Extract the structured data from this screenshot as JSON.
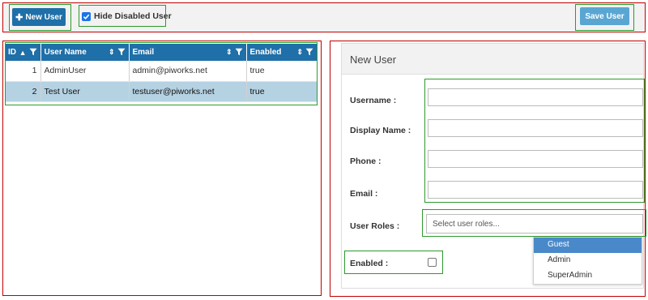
{
  "toolbar": {
    "new_user_label": "New User",
    "hide_disabled_label": "Hide Disabled User",
    "hide_disabled_checked": true,
    "save_label": "Save User"
  },
  "grid": {
    "columns": [
      "ID",
      "User Name",
      "Email",
      "Enabled"
    ],
    "rows": [
      {
        "id": "1",
        "name": "AdminUser",
        "email": "admin@piworks.net",
        "enabled": "true",
        "selected": false
      },
      {
        "id": "2",
        "name": "Test User",
        "email": "testuser@piworks.net",
        "enabled": "true",
        "selected": true
      }
    ]
  },
  "form": {
    "title": "New User",
    "username_label": "Username :",
    "display_name_label": "Display Name :",
    "phone_label": "Phone :",
    "email_label": "Email :",
    "roles_label": "User Roles :",
    "roles_placeholder": "Select user roles...",
    "enabled_label": "Enabled :",
    "roles_options": [
      "Guest",
      "Admin",
      "SuperAdmin"
    ],
    "roles_highlighted": "Guest"
  },
  "colors": {
    "header_blue": "#1f6fa8",
    "selected_row": "#b5d2e3",
    "save_button": "#5aa6d3",
    "annotation_red": "#c00000",
    "annotation_green": "#2e9a2e"
  }
}
